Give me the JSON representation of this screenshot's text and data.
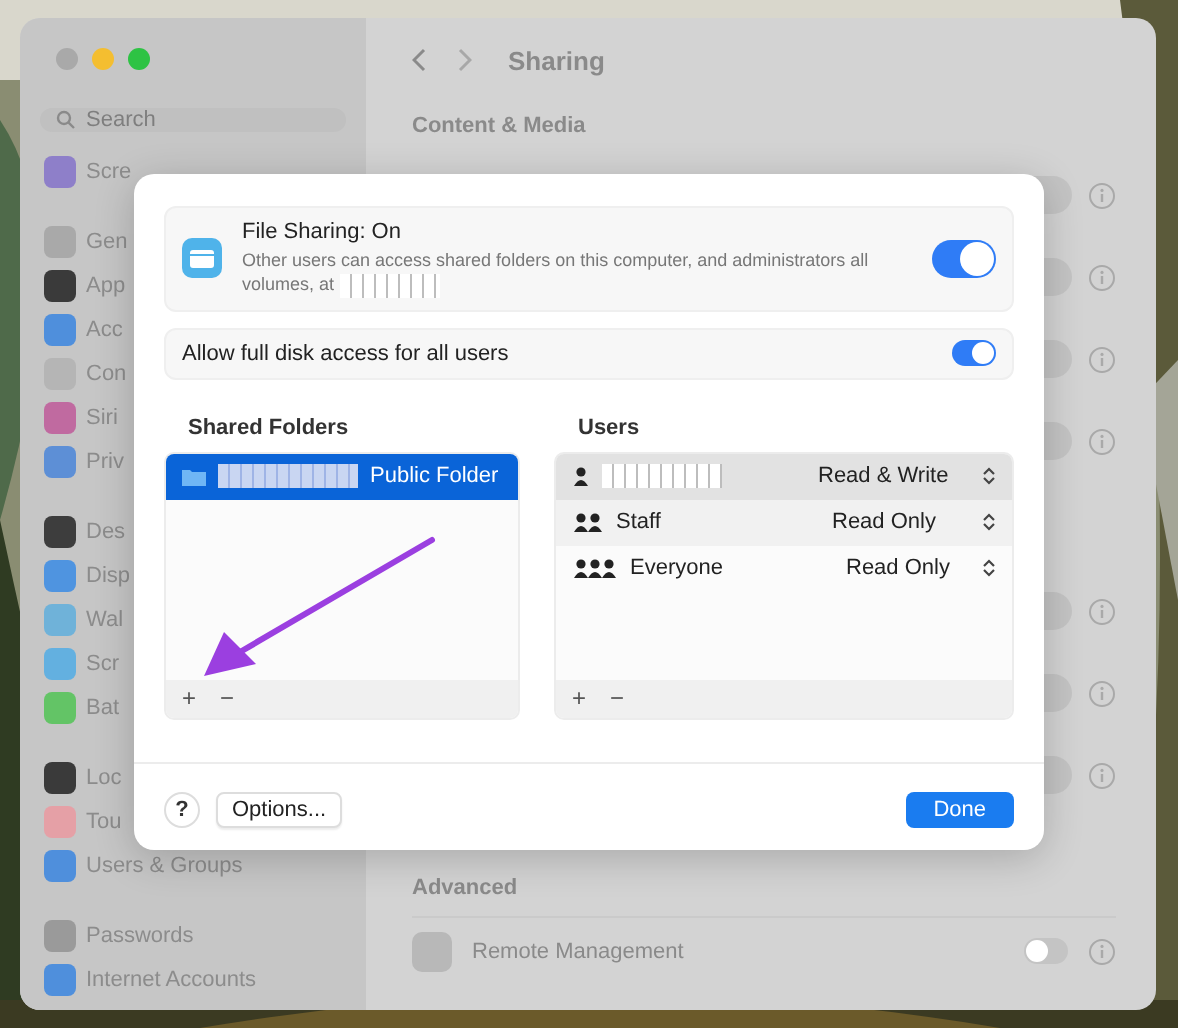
{
  "window": {
    "title": "Sharing"
  },
  "sidebar": {
    "search": {
      "placeholder": "Search"
    },
    "groups": [
      [
        {
          "label": "Scre",
          "color": "#8e7fc9"
        }
      ],
      [
        {
          "label": "Gen",
          "color": "#a9a9a9"
        },
        {
          "label": "App",
          "color": "#3a3a3a"
        },
        {
          "label": "Acc",
          "color": "#4f8fdc"
        },
        {
          "label": "Con",
          "color": "#b5b5b5"
        },
        {
          "label": "Siri",
          "color": "#c06aa0"
        },
        {
          "label": "Priv",
          "color": "#5d8fd6"
        }
      ],
      [
        {
          "label": "Des",
          "color": "#3d3d3d"
        },
        {
          "label": "Disp",
          "color": "#4f94e0"
        },
        {
          "label": "Wal",
          "color": "#6fb2d9"
        },
        {
          "label": "Scr",
          "color": "#63b0e0"
        },
        {
          "label": "Bat",
          "color": "#63c466"
        }
      ],
      [
        {
          "label": "Loc",
          "color": "#3a3a3a"
        },
        {
          "label": "Tou",
          "color": "#e5a0a6"
        },
        {
          "label": "Users & Groups",
          "color": "#4f8fdc"
        }
      ],
      [
        {
          "label": "Passwords",
          "color": "#9a9a9a"
        },
        {
          "label": "Internet Accounts",
          "color": "#4f8fdc"
        }
      ]
    ]
  },
  "main": {
    "section": "Content & Media",
    "row_groups": [
      [
        {
          "on": false
        },
        {
          "on": false
        },
        {
          "on": false
        },
        {
          "on": false
        }
      ],
      [
        {
          "on": false
        },
        {
          "on": false
        },
        {
          "on": false
        }
      ]
    ],
    "advanced": {
      "title": "Advanced",
      "rows": [
        {
          "label": "Remote Management",
          "on": false
        }
      ]
    }
  },
  "sheet": {
    "file_sharing": {
      "title": "File Sharing: On",
      "description": "Other users can access shared folders on this computer, and administrators all volumes, at",
      "on": true
    },
    "full_disk": {
      "label": "Allow full disk access for all users",
      "on": true
    },
    "shared_folders": {
      "title": "Shared Folders",
      "items": [
        {
          "label": "Public Folder",
          "selected": true
        }
      ],
      "add": "+",
      "remove": "−"
    },
    "users": {
      "title": "Users",
      "items": [
        {
          "kind": "user",
          "permission": "Read & Write",
          "selected": true
        },
        {
          "kind": "group",
          "name": "Staff",
          "permission": "Read Only",
          "selected": false
        },
        {
          "kind": "everyone",
          "name": "Everyone",
          "permission": "Read Only",
          "selected": false
        }
      ],
      "add": "+",
      "remove": "−"
    },
    "help": "?",
    "options": "Options...",
    "done": "Done"
  }
}
